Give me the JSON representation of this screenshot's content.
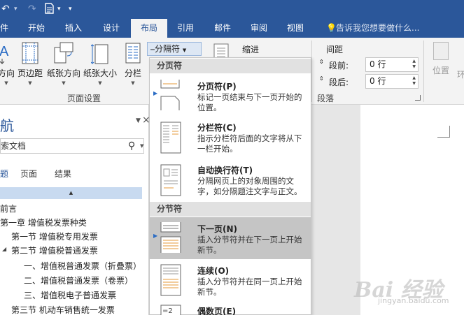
{
  "qat": {
    "undo_icon": "undo-icon",
    "redo_icon": "redo-icon",
    "doc_icon": "document-icon"
  },
  "tabs": [
    {
      "label": "件"
    },
    {
      "label": "开始"
    },
    {
      "label": "插入"
    },
    {
      "label": "设计"
    },
    {
      "label": "布局"
    },
    {
      "label": "引用"
    },
    {
      "label": "邮件"
    },
    {
      "label": "审阅"
    },
    {
      "label": "视图"
    }
  ],
  "active_tab": "布局",
  "tell_me": "告诉我您想要做什么...",
  "ribbon": {
    "text_direction": "方向",
    "margins": "页边距",
    "orientation": "纸张方向",
    "size": "纸张大小",
    "columns": "分栏",
    "page_setup_label": "页面设置",
    "breaks": "分隔符",
    "indent": "缩进",
    "spacing": "间距",
    "before_label": "段前:",
    "before_value": "0 行",
    "after_label": "段后:",
    "after_value": "0 行",
    "paragraph_label": "段落",
    "position": "位置",
    "wrap": "环"
  },
  "nav": {
    "title": "航",
    "search_value": "索文档",
    "tabs": [
      "题",
      "页面",
      "结果"
    ],
    "tree": [
      {
        "label": "前言",
        "arrow": ""
      },
      {
        "label": "第一章  增值税发票种类",
        "arrow": "◢"
      },
      {
        "label": "第一节  增值税专用发票",
        "arrow": ""
      },
      {
        "label": "第二节  增值税普通发票",
        "arrow": "◢"
      },
      {
        "label": "一、增值税普通发票（折叠票）",
        "arrow": ""
      },
      {
        "label": "二、增值税普通发票（卷票）",
        "arrow": ""
      },
      {
        "label": "三、增值税电子普通发票",
        "arrow": ""
      },
      {
        "label": "第三节  机动车销售统一发票",
        "arrow": ""
      }
    ]
  },
  "menu": {
    "section_page": "分页符",
    "section_section": "分节符",
    "items": [
      {
        "title": "分页符(P)",
        "desc": "标记一页结束与下一页开始的位置。"
      },
      {
        "title": "分栏符(C)",
        "desc": "指示分栏符后面的文字将从下一栏开始。"
      },
      {
        "title": "自动换行符(T)",
        "desc": "分隔网页上的对象周围的文字，如分隔题注文字与正文。"
      },
      {
        "title": "下一页(N)",
        "desc": "插入分节符并在下一页上开始新节。"
      },
      {
        "title": "连续(O)",
        "desc": "插入分节符并在同一页上开始新节。"
      },
      {
        "title": "偶数页(E)",
        "desc": ""
      }
    ]
  },
  "watermark": {
    "logo": "Bai 经验",
    "url": "jingyan.baidu.com"
  }
}
